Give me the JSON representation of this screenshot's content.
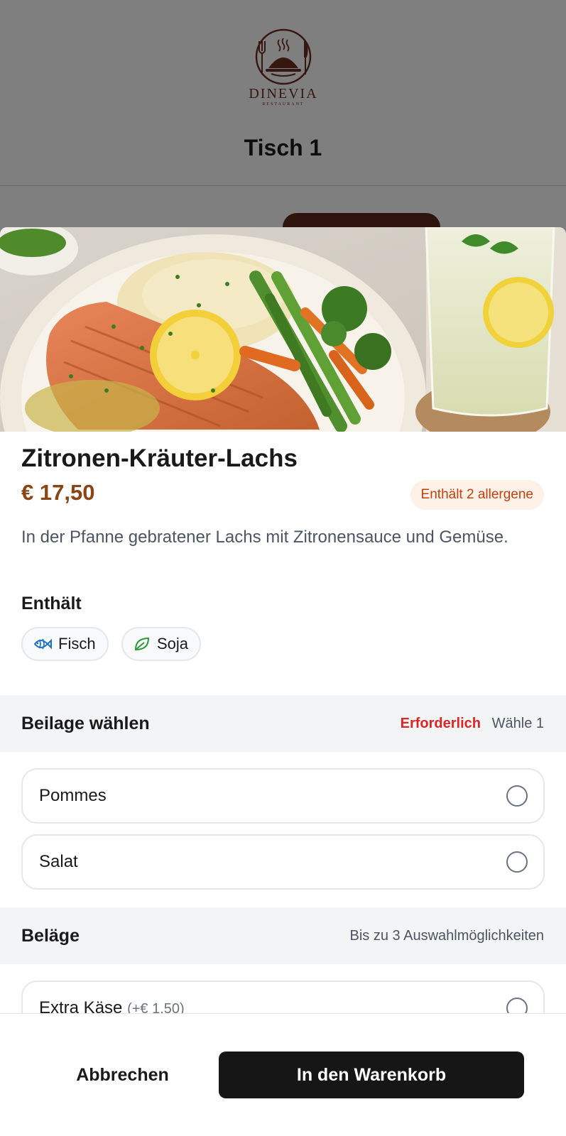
{
  "header": {
    "logo": {
      "name": "DINEVIA",
      "subtitle": "RESTAURANT",
      "icon": "cloche-icon"
    },
    "table_title": "Tisch 1"
  },
  "dish": {
    "name": "Zitronen-Kräuter-Lachs",
    "price": "€ 17,50",
    "allergen_badge": "Enthält 2 allergene",
    "description": "In der Pfanne gebratener Lachs mit Zitronensauce und Gemüse.",
    "contains_label": "Enthält",
    "allergens": [
      {
        "label": "Fisch",
        "icon": "fish-icon"
      },
      {
        "label": "Soja",
        "icon": "leaf-icon"
      }
    ]
  },
  "sections": [
    {
      "title": "Beilage wählen",
      "required": "Erforderlich",
      "hint": "Wähle 1",
      "options": [
        {
          "label": "Pommes",
          "selected": false
        },
        {
          "label": "Salat",
          "selected": false
        }
      ]
    },
    {
      "title": "Beläge",
      "hint": "Bis zu 3 Auswahlmöglichkeiten",
      "options": [
        {
          "label": "Extra Käse",
          "extra": "(+€ 1,50)",
          "selected": false
        }
      ]
    }
  ],
  "footer": {
    "cancel_label": "Abbrechen",
    "add_label": "In den Warenkorb"
  },
  "colors": {
    "price": "#8b4513",
    "required": "#dc2626",
    "allergen_badge_text": "#c2410c",
    "allergen_badge_bg": "#fdf1e8",
    "primary_button": "#161616"
  }
}
